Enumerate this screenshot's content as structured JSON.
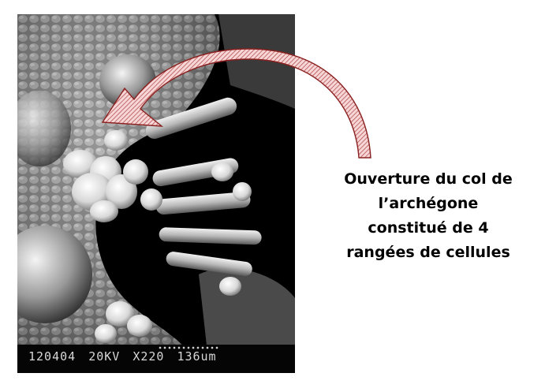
{
  "micrograph": {
    "id_label": "120404",
    "voltage_label": "20KV",
    "magnification_label": "X220",
    "scale_label": "136um"
  },
  "caption": {
    "lines": [
      "Ouverture du col de",
      "l’archégone",
      "constitué de 4",
      "rangées de cellules"
    ]
  },
  "arrow": {
    "fill_color": "#e8b0b0",
    "stroke_color": "#8a2020"
  }
}
